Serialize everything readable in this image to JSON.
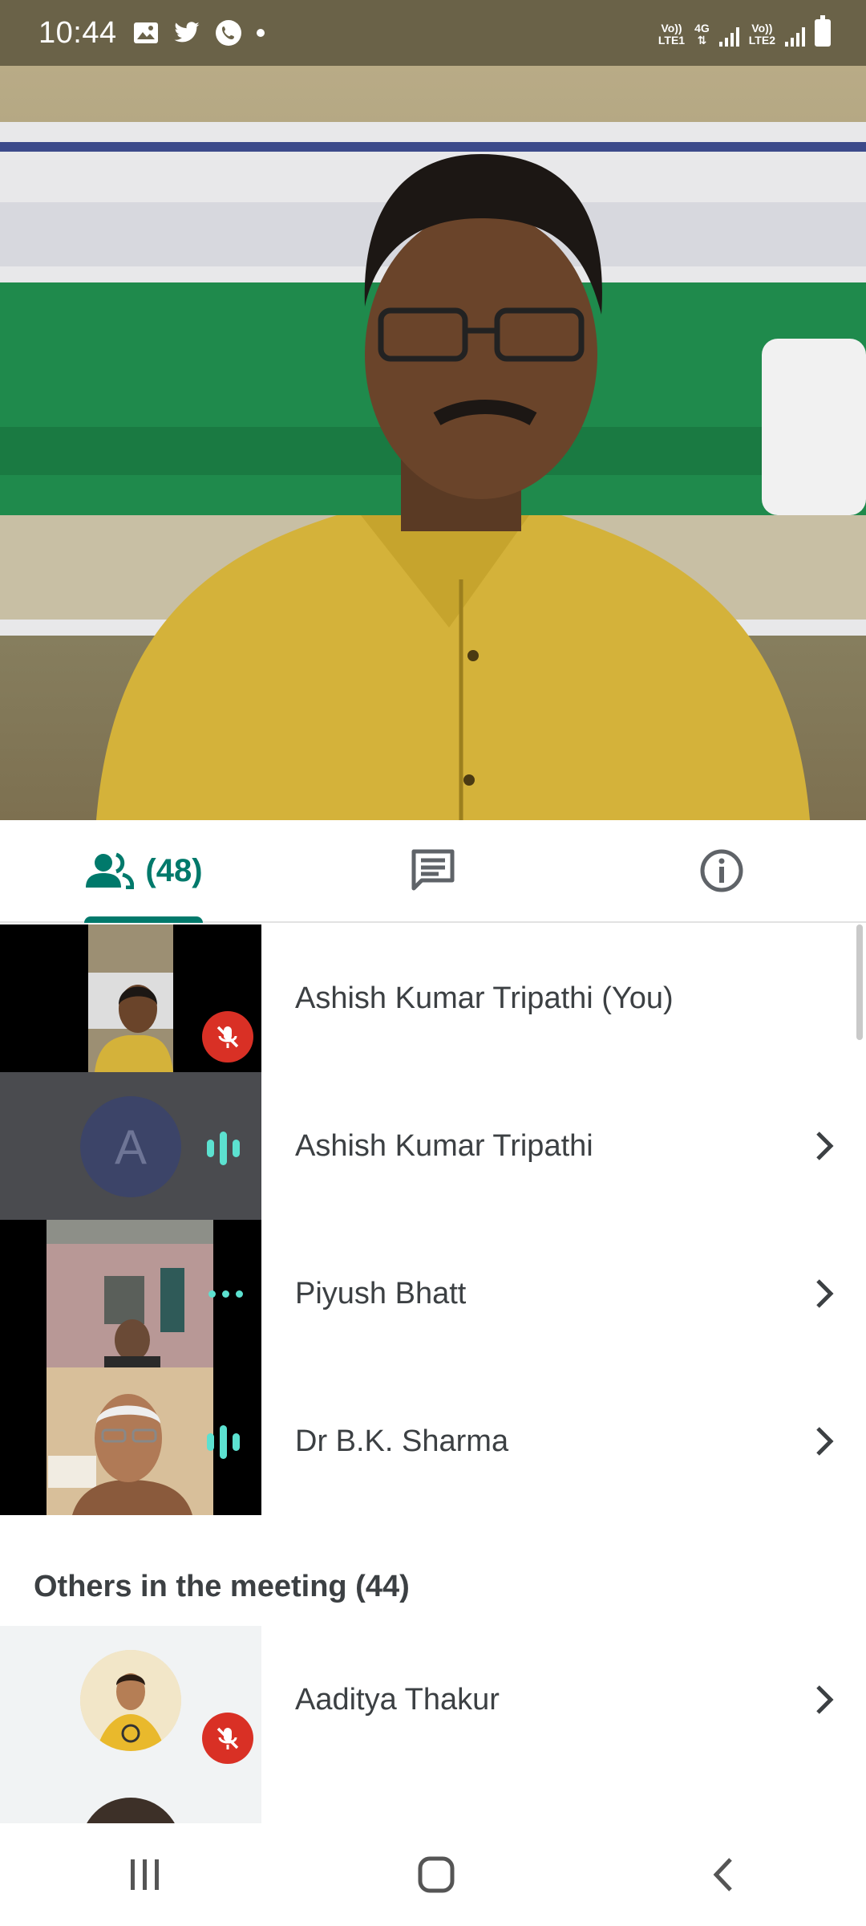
{
  "status_bar": {
    "time": "10:44",
    "left_icons": [
      "gallery-icon",
      "twitter-icon",
      "phone-icon",
      "dot-icon"
    ],
    "sim1_label_top": "Vo))",
    "sim1_label_bottom": "LTE1",
    "network_type": "4G",
    "sim2_label_top": "Vo))",
    "sim2_label_bottom": "LTE2"
  },
  "tabs": {
    "people_count": "(48)",
    "chat_icon": "chat-icon",
    "info_icon": "info-icon",
    "accent": "#00796b"
  },
  "participants": [
    {
      "name": "Ashish Kumar Tripathi (You)",
      "status": "muted",
      "tile": "video"
    },
    {
      "name": "Ashish Kumar Tripathi",
      "status": "speaking",
      "tile": "avatar",
      "avatar_letter": "A"
    },
    {
      "name": "Piyush Bhatt",
      "status": "connecting",
      "tile": "video"
    },
    {
      "name": "Dr B.K. Sharma",
      "status": "speaking",
      "tile": "video"
    }
  ],
  "others_section": {
    "title": "Others in the meeting (44)",
    "items": [
      {
        "name": "Aaditya Thakur",
        "status": "muted",
        "tile": "photo"
      }
    ]
  },
  "colors": {
    "mute_red": "#d93025",
    "speaking": "#5ce1d0",
    "avatar_bg": "#3c4468"
  },
  "nav_bar": {
    "icons": [
      "recents-icon",
      "home-icon",
      "back-icon"
    ]
  }
}
